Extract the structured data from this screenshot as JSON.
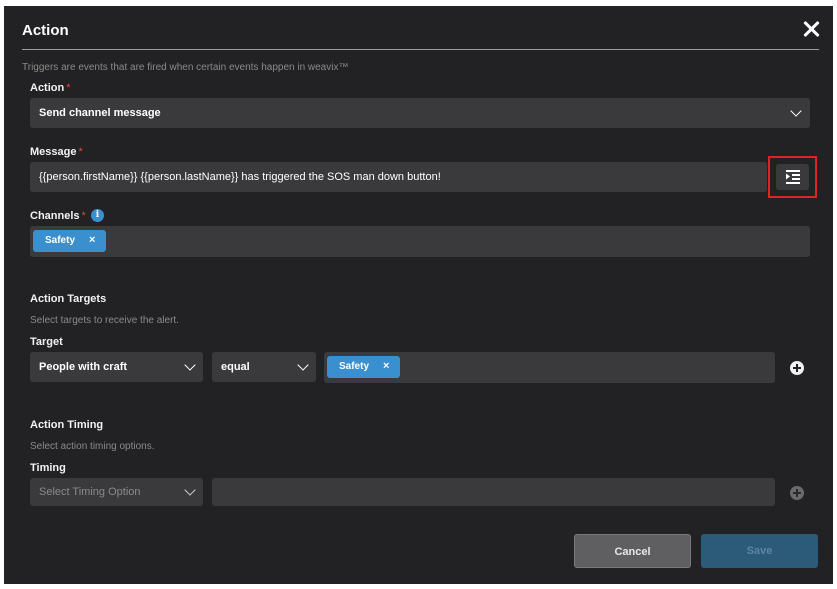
{
  "dialog": {
    "title": "Action",
    "description": "Triggers are events that are fired when certain events happen in weavix™"
  },
  "action": {
    "label": "Action",
    "required_mark": "*",
    "value": "Send channel message"
  },
  "message": {
    "label": "Message",
    "required_mark": "*",
    "value": "{{person.firstName}} {{person.lastName}} has triggered the SOS man down button!"
  },
  "channels": {
    "label": "Channels",
    "required_mark": "*",
    "info_glyph": "i",
    "chips": [
      {
        "label": "Safety",
        "remove": "×"
      }
    ]
  },
  "targets": {
    "heading": "Action Targets",
    "description": "Select targets to receive the alert.",
    "label": "Target",
    "target_type": "People with craft",
    "operator": "equal",
    "chips": [
      {
        "label": "Safety",
        "remove": "×"
      }
    ]
  },
  "timing": {
    "heading": "Action Timing",
    "description": "Select action timing options.",
    "label": "Timing",
    "placeholder": "Select Timing Option"
  },
  "footer": {
    "cancel_label": "Cancel",
    "save_label": "Save"
  },
  "colors": {
    "background": "#222224",
    "field": "#3a3a3c",
    "accent": "#3a8fce",
    "required": "#e0463a",
    "highlight": "#e02424"
  },
  "icons": {
    "close": "close-icon",
    "format": "text-indent-icon",
    "dropdown": "chevron-down-icon",
    "add": "plus-circle-icon",
    "info": "info-icon"
  }
}
